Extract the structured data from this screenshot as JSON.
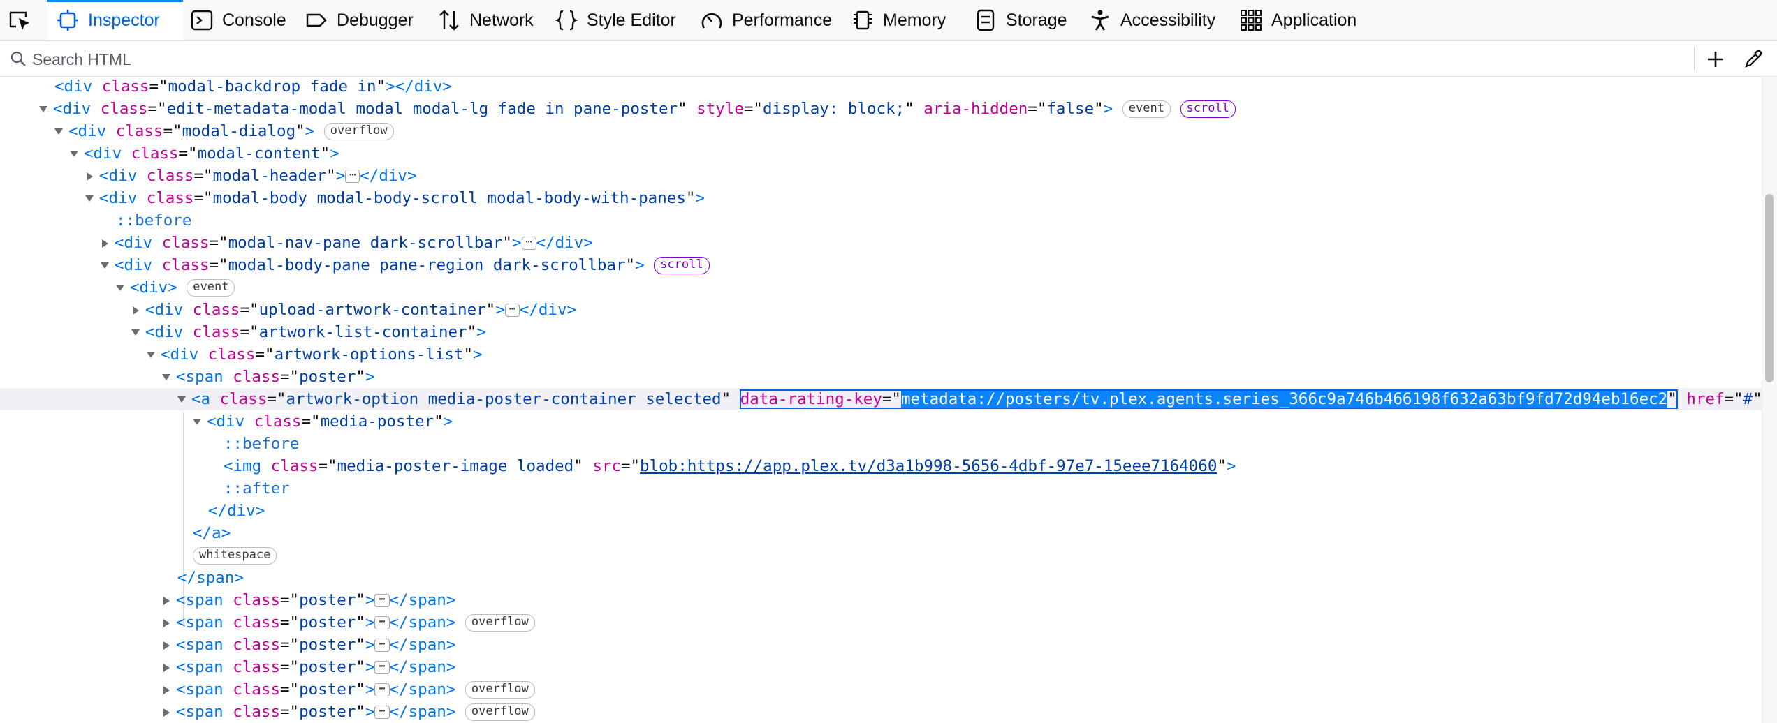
{
  "toolbar": {
    "tabs": [
      {
        "label": "Inspector",
        "icon": "inspector-icon"
      },
      {
        "label": "Console",
        "icon": "console-icon"
      },
      {
        "label": "Debugger",
        "icon": "debugger-icon"
      },
      {
        "label": "Network",
        "icon": "network-icon"
      },
      {
        "label": "Style Editor",
        "icon": "style-editor-icon"
      },
      {
        "label": "Performance",
        "icon": "performance-icon"
      },
      {
        "label": "Memory",
        "icon": "memory-icon"
      },
      {
        "label": "Storage",
        "icon": "storage-icon"
      },
      {
        "label": "Accessibility",
        "icon": "accessibility-icon"
      },
      {
        "label": "Application",
        "icon": "application-icon"
      }
    ],
    "active_tab": "Inspector",
    "accent_color": "#0060df"
  },
  "search": {
    "placeholder": "Search HTML",
    "value": ""
  },
  "markup": {
    "lines": [
      {
        "id": "L0",
        "tag": "div",
        "class": "modal-backdrop fade in",
        "close": "div"
      },
      {
        "id": "L1",
        "tag": "div",
        "class": "edit-metadata-modal modal modal-lg fade in pane-poster",
        "style": "display: block;",
        "aria_hidden": "false",
        "badges": [
          "event",
          "scroll"
        ]
      },
      {
        "id": "L2",
        "tag": "div",
        "class": "modal-dialog",
        "badges": [
          "overflow"
        ]
      },
      {
        "id": "L3",
        "tag": "div",
        "class": "modal-content"
      },
      {
        "id": "L4",
        "tag": "div",
        "class": "modal-header",
        "collapsed": true,
        "close": "div"
      },
      {
        "id": "L5",
        "tag": "div",
        "class": "modal-body modal-body-scroll modal-body-with-panes"
      },
      {
        "id": "L6",
        "pseudo": "::before"
      },
      {
        "id": "L7",
        "tag": "div",
        "class": "modal-nav-pane dark-scrollbar",
        "collapsed": true,
        "close": "div"
      },
      {
        "id": "L8",
        "tag": "div",
        "class": "modal-body-pane pane-region dark-scrollbar",
        "badges": [
          "scroll"
        ]
      },
      {
        "id": "L9",
        "tag": "div",
        "badges": [
          "event"
        ]
      },
      {
        "id": "L10",
        "tag": "div",
        "class": "upload-artwork-container",
        "collapsed": true,
        "close": "div"
      },
      {
        "id": "L11",
        "tag": "div",
        "class": "artwork-list-container"
      },
      {
        "id": "L12",
        "tag": "div",
        "class": "artwork-options-list"
      },
      {
        "id": "L13",
        "tag": "span",
        "class": "poster"
      },
      {
        "id": "L14",
        "tag": "a",
        "class": "artwork-option media-poster-container selected",
        "data_rating_key": "metadata://posters/tv.plex.agents.series_366c9a746b466198f632a63bf9fd72d94eb16ec2",
        "href": "#",
        "selected": true
      },
      {
        "id": "L15",
        "tag": "div",
        "class": "media-poster"
      },
      {
        "id": "L16",
        "pseudo": "::before"
      },
      {
        "id": "L17",
        "tag": "img",
        "class": "media-poster-image loaded",
        "src": "blob:https://app.plex.tv/d3a1b998-5656-4dbf-97e7-15eee7164060"
      },
      {
        "id": "L18",
        "pseudo": "::after"
      },
      {
        "id": "L19",
        "close": "div"
      },
      {
        "id": "L20",
        "close": "a"
      },
      {
        "id": "L21",
        "badges": [
          "whitespace"
        ]
      },
      {
        "id": "L22",
        "close": "span"
      },
      {
        "id": "L23",
        "tag": "span",
        "class": "poster",
        "collapsed": true,
        "close": "span"
      },
      {
        "id": "L24",
        "tag": "span",
        "class": "poster",
        "collapsed": true,
        "close": "span",
        "badges": [
          "overflow"
        ]
      },
      {
        "id": "L25",
        "tag": "span",
        "class": "poster",
        "collapsed": true,
        "close": "span"
      },
      {
        "id": "L26",
        "tag": "span",
        "class": "poster",
        "collapsed": true,
        "close": "span"
      },
      {
        "id": "L27",
        "tag": "span",
        "class": "poster",
        "collapsed": true,
        "close": "span",
        "badges": [
          "overflow"
        ]
      },
      {
        "id": "L28",
        "tag": "span",
        "class": "poster",
        "collapsed": true,
        "close": "span",
        "badges": [
          "overflow"
        ]
      }
    ],
    "attr_names": {
      "class": "class",
      "style": "style",
      "aria_hidden": "aria-hidden",
      "data_rating_key": "data-rating-key",
      "href": "href",
      "src": "src"
    },
    "ellipsis": "⋯"
  }
}
